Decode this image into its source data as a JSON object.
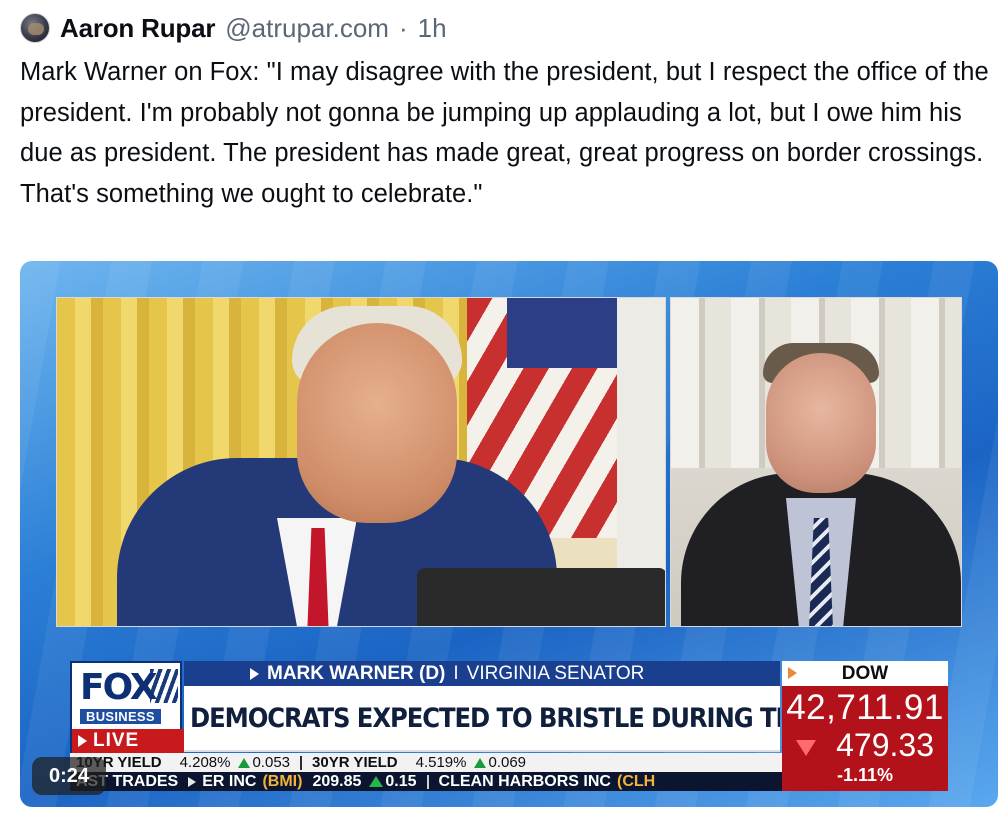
{
  "post": {
    "author_name": "Aaron Rupar",
    "author_handle": "@atrupar.com",
    "separator": "·",
    "time_ago": "1h",
    "text": "Mark Warner on Fox: \"I may disagree with the president, but I respect the office of the president. I'm probably not gonna be jumping up applauding a lot, but I owe him his due as president. The president has made great, great progress on border crossings. That's something we ought to celebrate.\""
  },
  "video": {
    "timestamp": "0:24",
    "chyron": {
      "network": "FOX",
      "network_sub": "BUSINESS",
      "live_label": "LIVE",
      "name": "MARK WARNER (D)",
      "name_sep": "I",
      "title": "VIRGINIA SENATOR",
      "headline": "DEMOCRATS EXPECTED TO BRISTLE DURING TRUMP SPEECH",
      "dow": {
        "label": "DOW",
        "value": "42,711.91",
        "change": "479.33",
        "pct": "-1.11",
        "pct_sign": "%"
      },
      "ticker": {
        "row1": {
          "item1_label": "10YR YIELD",
          "item1_value": "4.208%",
          "item1_change": "0.053",
          "item2_label": "30YR YIELD",
          "item2_value": "4.519%",
          "item2_change": "0.069"
        },
        "row2": {
          "prefix": "AST TRADES",
          "item1_name": "ER INC",
          "item1_sym": "(BMI)",
          "item1_price": "209.85",
          "item1_change": "0.15",
          "item2_name": "CLEAN HARBORS INC",
          "item2_sym": "(CLH"
        }
      }
    }
  },
  "colors": {
    "fox_blue": "#1b3f8f",
    "live_red": "#c81a1d",
    "dow_red": "#b3121a",
    "up_green": "#1a9a3a",
    "ticker_gold": "#f3b23a"
  },
  "icons": {
    "avatar": "profile-avatar",
    "live_arrow": "play-triangle-icon",
    "up": "up-triangle-icon",
    "down": "down-triangle-icon"
  }
}
